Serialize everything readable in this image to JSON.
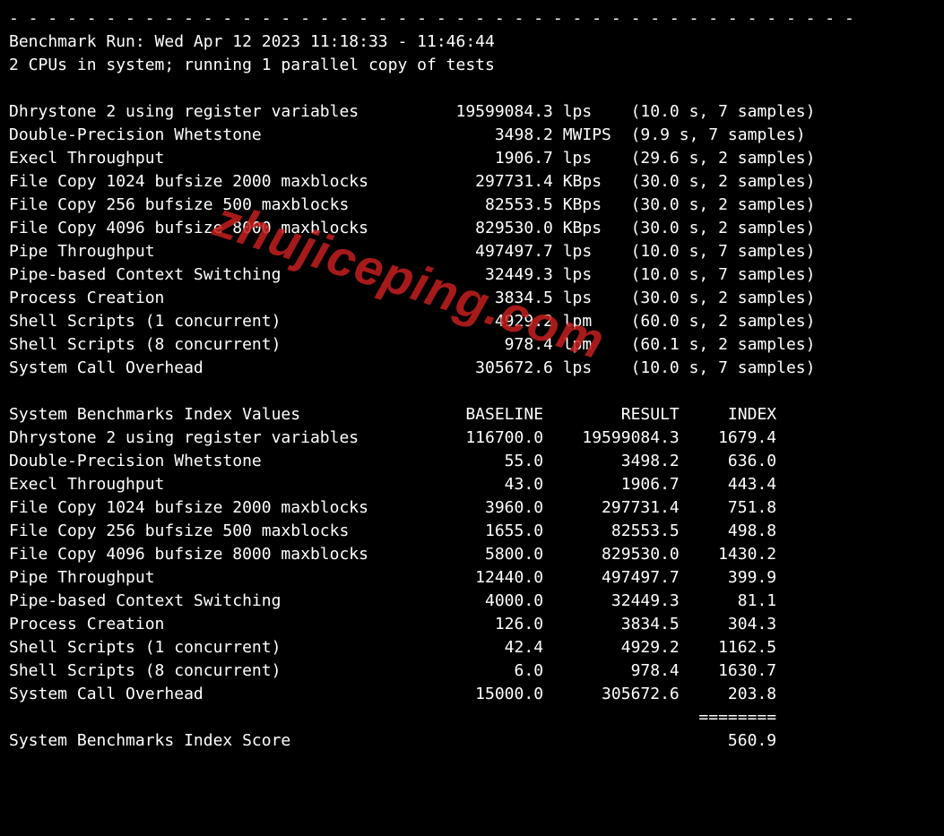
{
  "separator": "- - - - - - - - - - - - - - - - - - - - - - - - - - - - - - - - - - - - - - - - - - - -",
  "header": {
    "run_line": "Benchmark Run: Wed Apr 12 2023 11:18:33 - 11:46:44",
    "cpu_line": "2 CPUs in system; running 1 parallel copy of tests"
  },
  "tests": [
    {
      "name": "Dhrystone 2 using register variables",
      "value": "19599084.3",
      "unit": "lps",
      "timing": "(10.0 s, 7 samples)"
    },
    {
      "name": "Double-Precision Whetstone",
      "value": "3498.2",
      "unit": "MWIPS",
      "timing": "(9.9 s, 7 samples)"
    },
    {
      "name": "Execl Throughput",
      "value": "1906.7",
      "unit": "lps",
      "timing": "(29.6 s, 2 samples)"
    },
    {
      "name": "File Copy 1024 bufsize 2000 maxblocks",
      "value": "297731.4",
      "unit": "KBps",
      "timing": "(30.0 s, 2 samples)"
    },
    {
      "name": "File Copy 256 bufsize 500 maxblocks",
      "value": "82553.5",
      "unit": "KBps",
      "timing": "(30.0 s, 2 samples)"
    },
    {
      "name": "File Copy 4096 bufsize 8000 maxblocks",
      "value": "829530.0",
      "unit": "KBps",
      "timing": "(30.0 s, 2 samples)"
    },
    {
      "name": "Pipe Throughput",
      "value": "497497.7",
      "unit": "lps",
      "timing": "(10.0 s, 7 samples)"
    },
    {
      "name": "Pipe-based Context Switching",
      "value": "32449.3",
      "unit": "lps",
      "timing": "(10.0 s, 7 samples)"
    },
    {
      "name": "Process Creation",
      "value": "3834.5",
      "unit": "lps",
      "timing": "(30.0 s, 2 samples)"
    },
    {
      "name": "Shell Scripts (1 concurrent)",
      "value": "4929.2",
      "unit": "lpm",
      "timing": "(60.0 s, 2 samples)"
    },
    {
      "name": "Shell Scripts (8 concurrent)",
      "value": "978.4",
      "unit": "lpm",
      "timing": "(60.1 s, 2 samples)"
    },
    {
      "name": "System Call Overhead",
      "value": "305672.6",
      "unit": "lps",
      "timing": "(10.0 s, 7 samples)"
    }
  ],
  "index_header": {
    "title": "System Benchmarks Index Values",
    "col1": "BASELINE",
    "col2": "RESULT",
    "col3": "INDEX"
  },
  "index": [
    {
      "name": "Dhrystone 2 using register variables",
      "baseline": "116700.0",
      "result": "19599084.3",
      "index": "1679.4"
    },
    {
      "name": "Double-Precision Whetstone",
      "baseline": "55.0",
      "result": "3498.2",
      "index": "636.0"
    },
    {
      "name": "Execl Throughput",
      "baseline": "43.0",
      "result": "1906.7",
      "index": "443.4"
    },
    {
      "name": "File Copy 1024 bufsize 2000 maxblocks",
      "baseline": "3960.0",
      "result": "297731.4",
      "index": "751.8"
    },
    {
      "name": "File Copy 256 bufsize 500 maxblocks",
      "baseline": "1655.0",
      "result": "82553.5",
      "index": "498.8"
    },
    {
      "name": "File Copy 4096 bufsize 8000 maxblocks",
      "baseline": "5800.0",
      "result": "829530.0",
      "index": "1430.2"
    },
    {
      "name": "Pipe Throughput",
      "baseline": "12440.0",
      "result": "497497.7",
      "index": "399.9"
    },
    {
      "name": "Pipe-based Context Switching",
      "baseline": "4000.0",
      "result": "32449.3",
      "index": "81.1"
    },
    {
      "name": "Process Creation",
      "baseline": "126.0",
      "result": "3834.5",
      "index": "304.3"
    },
    {
      "name": "Shell Scripts (1 concurrent)",
      "baseline": "42.4",
      "result": "4929.2",
      "index": "1162.5"
    },
    {
      "name": "Shell Scripts (8 concurrent)",
      "baseline": "6.0",
      "result": "978.4",
      "index": "1630.7"
    },
    {
      "name": "System Call Overhead",
      "baseline": "15000.0",
      "result": "305672.6",
      "index": "203.8"
    }
  ],
  "footer": {
    "divider": "========",
    "score_label": "System Benchmarks Index Score",
    "score_value": "560.9"
  },
  "watermark": "zhujiceping.com"
}
